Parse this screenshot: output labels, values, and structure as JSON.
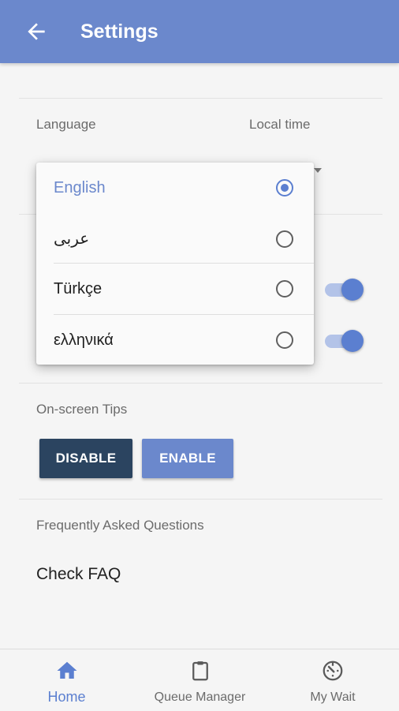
{
  "appbar": {
    "title": "Settings",
    "back_icon": "arrow-left-icon"
  },
  "settings": {
    "language_label": "Language",
    "localtime_label": "Local time",
    "tips_label": "On-screen Tips",
    "disable_button": "DISABLE",
    "enable_button": "ENABLE",
    "faq_label": "Frequently Asked Questions",
    "faq_link": "Check FAQ",
    "toggles": [
      {
        "on": true
      },
      {
        "on": true
      }
    ]
  },
  "language_menu": {
    "selected": "English",
    "options": [
      {
        "label": "English",
        "selected": true
      },
      {
        "label": "عربى",
        "selected": false
      },
      {
        "label": "Türkçe",
        "selected": false
      },
      {
        "label": "ελληνικά",
        "selected": false
      }
    ]
  },
  "bottom_nav": {
    "items": [
      {
        "label": "Home",
        "icon": "home-icon",
        "active": true
      },
      {
        "label": "Queue Manager",
        "icon": "clipboard-icon",
        "active": false
      },
      {
        "label": "My Wait",
        "icon": "timer-icon",
        "active": false
      }
    ]
  },
  "colors": {
    "primary": "#6b88cc",
    "dark_button": "#2b4460",
    "accent": "#5b7fd0"
  }
}
